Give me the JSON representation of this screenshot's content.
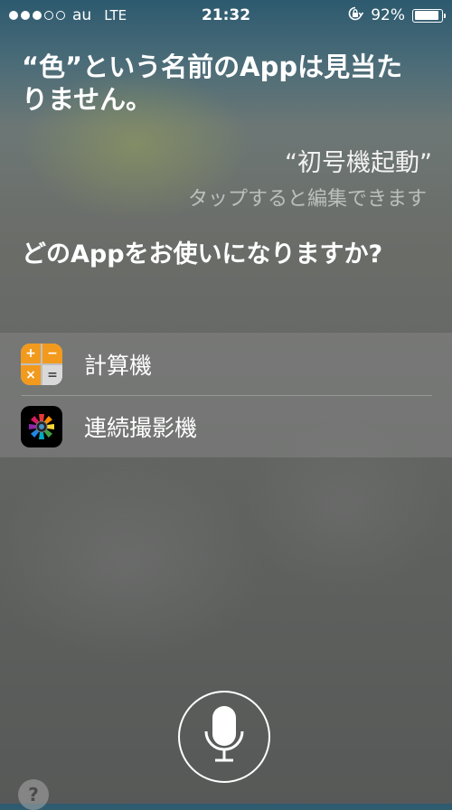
{
  "status_bar": {
    "carrier": "au",
    "network": "LTE",
    "time": "21:32",
    "battery_percent": "92%",
    "battery_level": 0.92,
    "signal_bars_filled": 3,
    "signal_bars_total": 5
  },
  "siri": {
    "response": "“色”という名前のAppは見当たりません。",
    "user_quote": "“初号機起動”",
    "tap_to_edit": "タップすると編集できます",
    "question": "どのAppをお使いになりますか?"
  },
  "apps": [
    {
      "name": "計算機",
      "icon": "calculator-icon"
    },
    {
      "name": "連続撮影機",
      "icon": "burst-camera-icon"
    }
  ],
  "calc_icon_keys": [
    "+",
    "−",
    "×",
    "="
  ],
  "help_label": "?",
  "colors": {
    "calc_orange": "#f29a1d",
    "list_background": "rgba(150,150,150,0.35)"
  }
}
